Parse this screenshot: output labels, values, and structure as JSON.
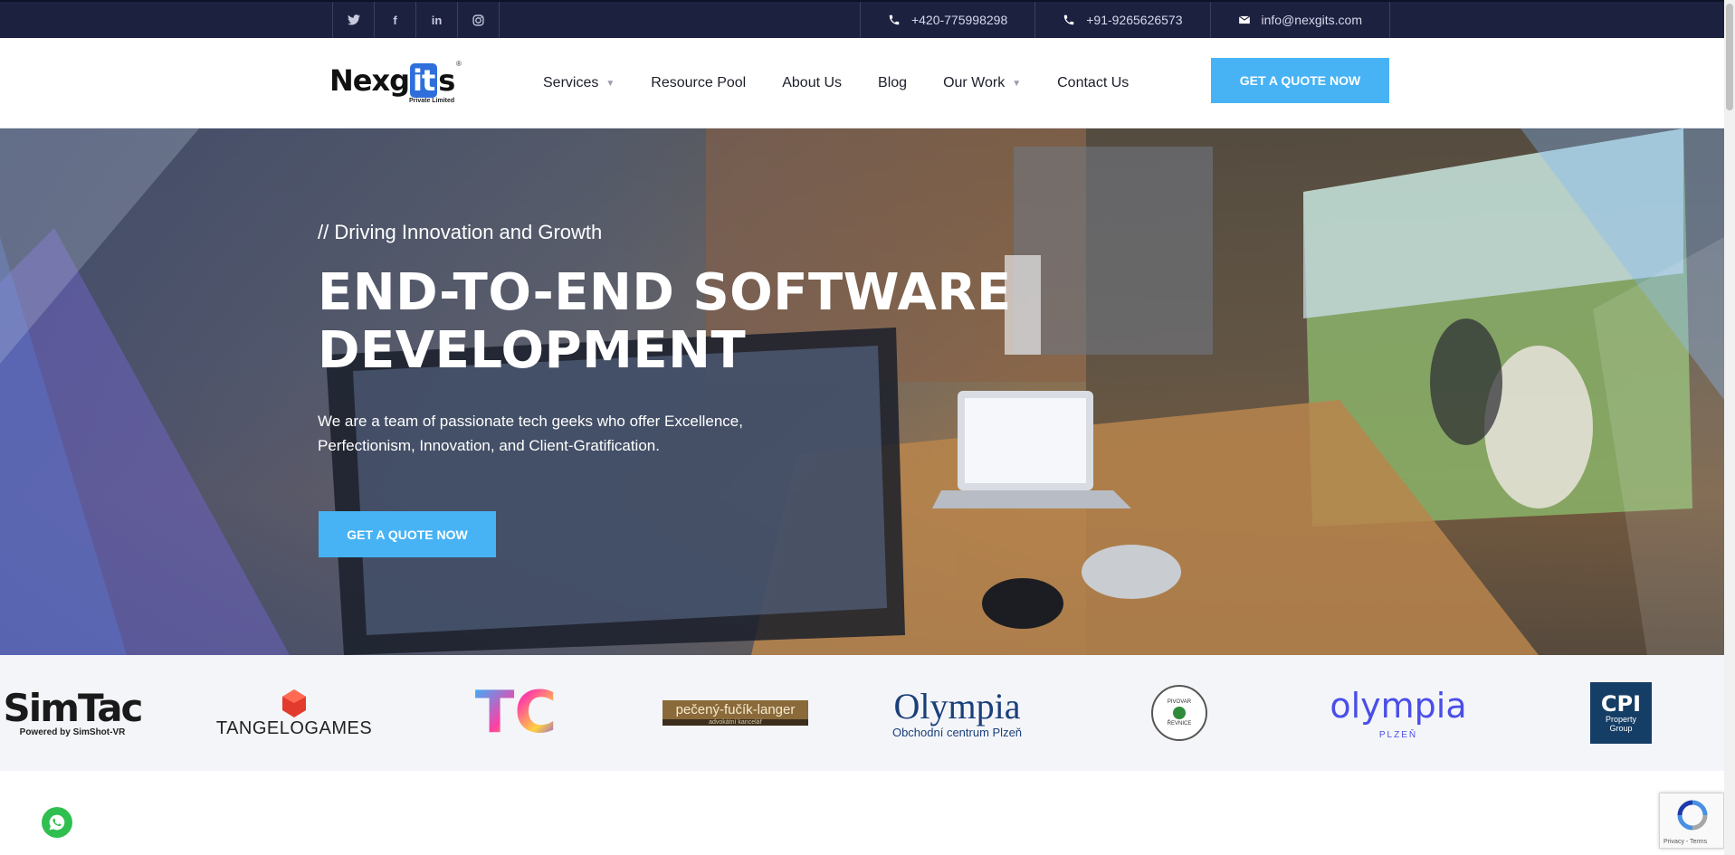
{
  "topbar": {
    "social": [
      {
        "icon": "twitter-icon",
        "glyph": "t"
      },
      {
        "icon": "facebook-icon",
        "glyph": "f"
      },
      {
        "icon": "linkedin-icon",
        "glyph": "in"
      },
      {
        "icon": "instagram-icon",
        "glyph": "◎"
      }
    ],
    "contacts": [
      {
        "icon": "phone-icon",
        "text": "+420-775998298"
      },
      {
        "icon": "phone-icon",
        "text": "+91-9265626573"
      },
      {
        "icon": "mail-icon",
        "text": "info@nexgits.com"
      }
    ]
  },
  "header": {
    "logo": {
      "pre": "Nexg",
      "mid": "it",
      "post": "s",
      "sub": "Private Limited",
      "reg": "®"
    },
    "nav": [
      {
        "label": "Services",
        "dropdown": true
      },
      {
        "label": "Resource Pool",
        "dropdown": false
      },
      {
        "label": "About Us",
        "dropdown": false
      },
      {
        "label": "Blog",
        "dropdown": false
      },
      {
        "label": "Our Work",
        "dropdown": true
      },
      {
        "label": "Contact Us",
        "dropdown": false
      }
    ],
    "cta": "GET A QUOTE NOW"
  },
  "hero": {
    "kicker": "// Driving Innovation and Growth",
    "title_line1": "END-TO-END SOFTWARE",
    "title_line2": "DEVELOPMENT",
    "desc": "We are a team of passionate tech geeks who offer Excellence, Perfectionism, Innovation, and Client-Gratification.",
    "cta": "GET A QUOTE NOW"
  },
  "partners": {
    "simtac": {
      "name": "SimTac",
      "sub": "Powered by SimShot-VR"
    },
    "tangelo": {
      "name": "TANGELOGAMES"
    },
    "tc": {
      "name": "TC"
    },
    "pecheny": {
      "name": "pečený-fučík-langer",
      "sub": "advokátní kancelář"
    },
    "olympia_oc": {
      "name": "Olympia",
      "sub": "Obchodní centrum Plzeň"
    },
    "pivovar": {
      "top": "PIVOVAR",
      "bottom": "ŘEVNICE"
    },
    "olympia_plzen": {
      "name": "olympia",
      "sub": "PLZEŇ"
    },
    "cpi": {
      "name": "CPI",
      "sub1": "Property",
      "sub2": "Group"
    }
  },
  "recaptcha": {
    "text": "Privacy - Terms"
  },
  "colors": {
    "topbar": "#1c2140",
    "accent": "#47b3f5",
    "logo_it": "#2f6fdc"
  }
}
